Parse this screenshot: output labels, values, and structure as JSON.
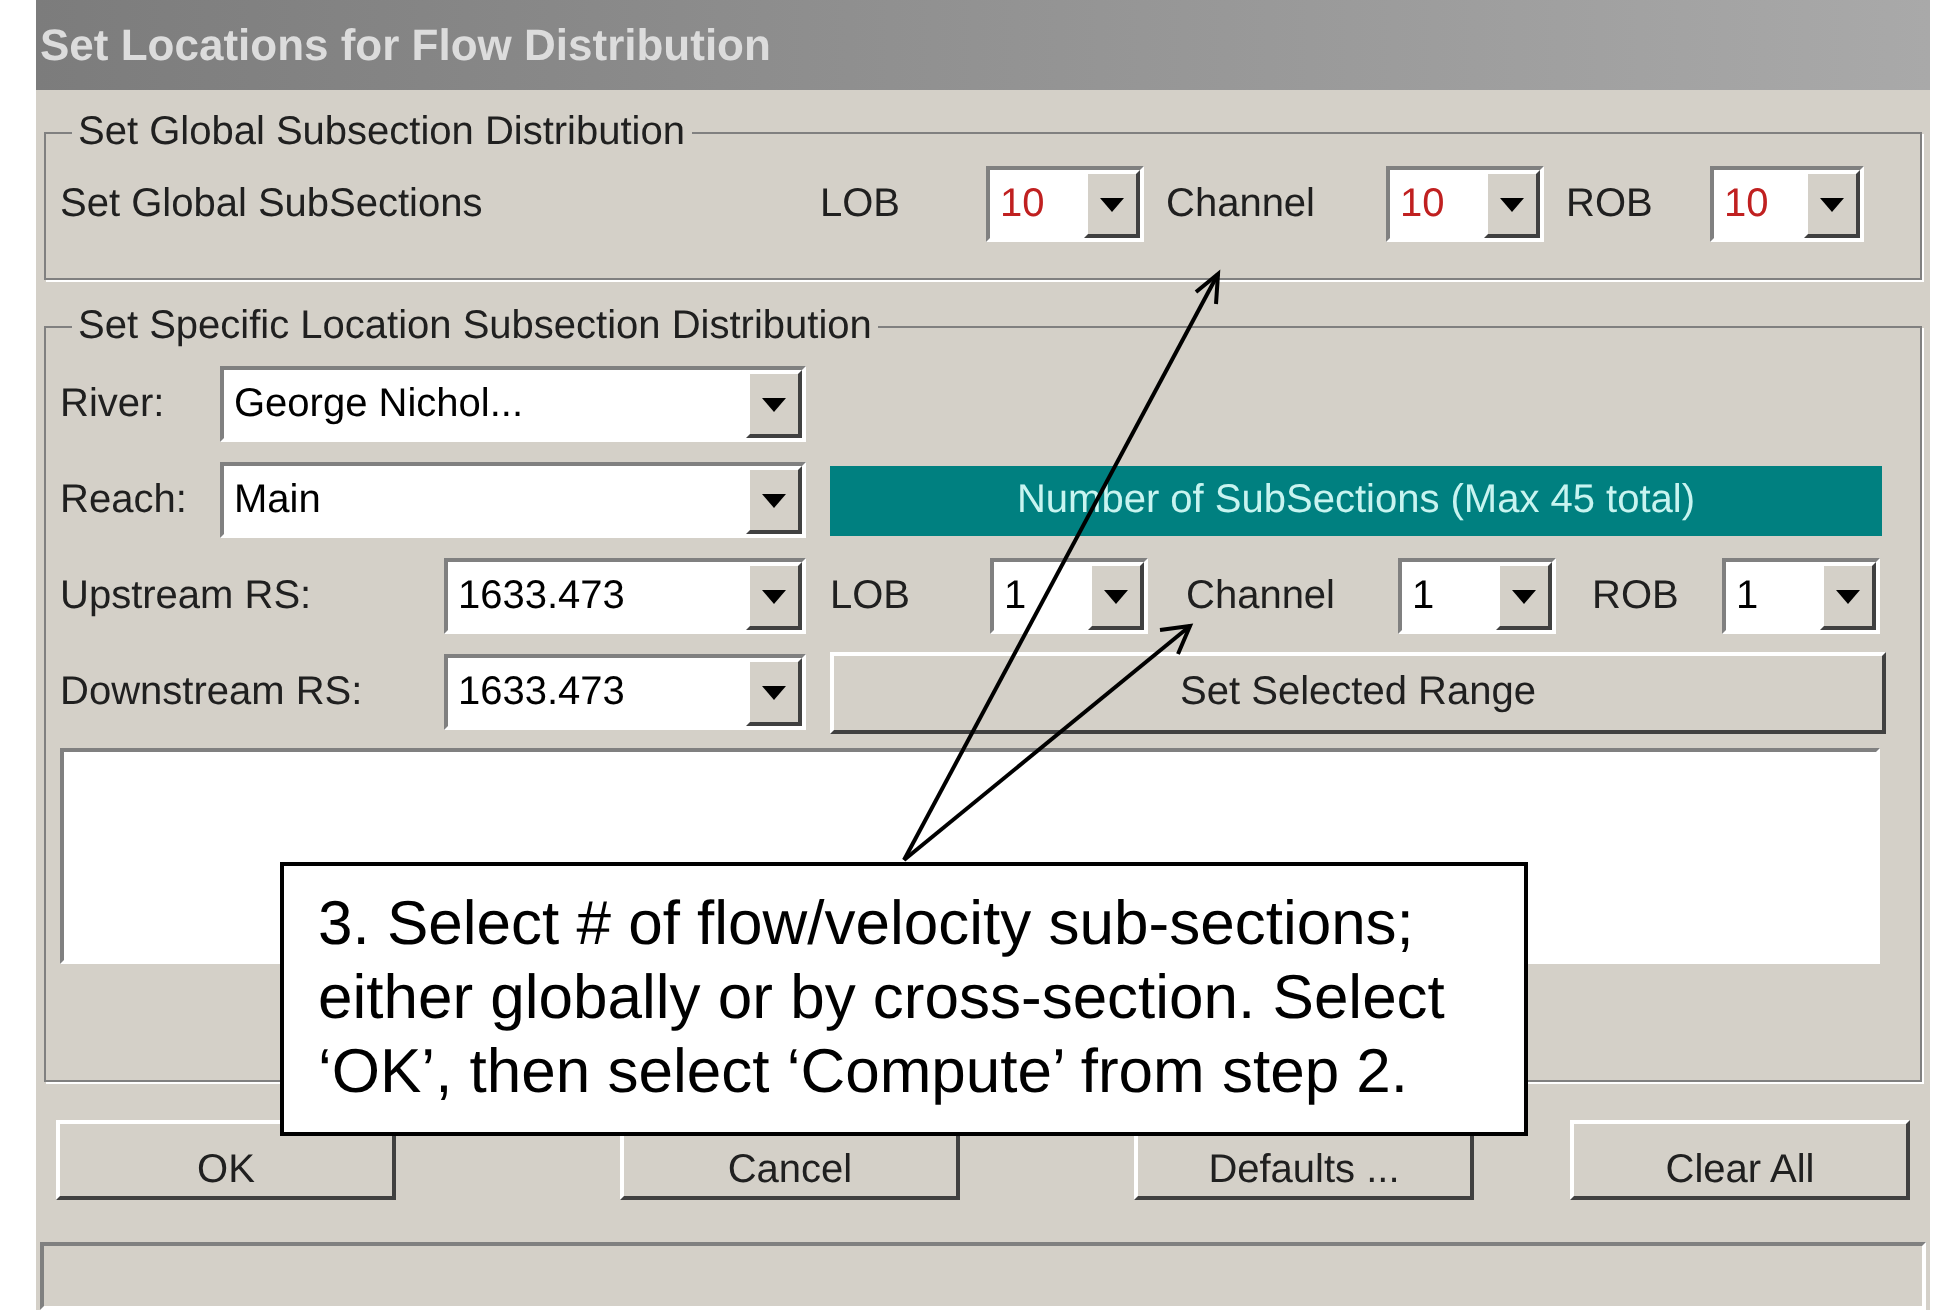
{
  "window": {
    "title": "Set Locations for Flow Distribution"
  },
  "global_group": {
    "title": "Set Global Subsection Distribution",
    "label": "Set Global SubSections",
    "fields": [
      {
        "label": "LOB",
        "value": "10"
      },
      {
        "label": "Channel",
        "value": "10"
      },
      {
        "label": "ROB",
        "value": "10"
      }
    ]
  },
  "specific_group": {
    "title": "Set Specific Location Subsection Distribution",
    "river": {
      "label": "River:",
      "value": "George Nichol..."
    },
    "reach": {
      "label": "Reach:",
      "value": "Main"
    },
    "upstream": {
      "label": "Upstream RS:",
      "value": "1633.473"
    },
    "downstream": {
      "label": "Downstream RS:",
      "value": "1633.473"
    },
    "banner": "Number of SubSections (Max 45 total)",
    "fields": [
      {
        "label": "LOB",
        "value": "1"
      },
      {
        "label": "Channel",
        "value": "1"
      },
      {
        "label": "ROB",
        "value": "1"
      }
    ],
    "range_button": "Set Selected Range"
  },
  "buttons": [
    "OK",
    "Cancel",
    "Defaults ...",
    "Clear All"
  ],
  "callout": "3. Select # of flow/velocity sub-sections; either globally or by cross-section. Select ‘OK’, then select ‘Compute’ from step 2."
}
